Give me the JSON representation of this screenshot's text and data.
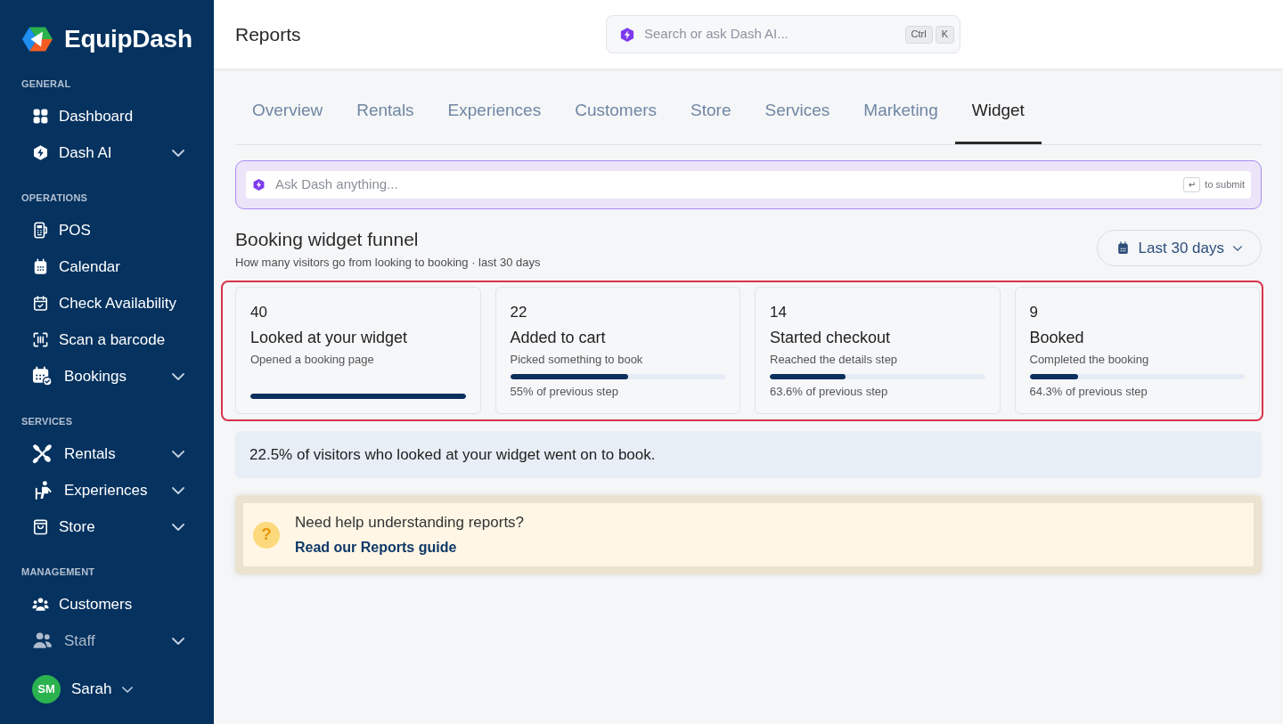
{
  "sidebar": {
    "brand": "EquipDash",
    "sections": [
      {
        "title": "GENERAL",
        "items": [
          {
            "label": "Dashboard",
            "kind": "link",
            "dimmed": false
          },
          {
            "label": "Dash AI",
            "kind": "group",
            "dimmed": false
          }
        ]
      },
      {
        "title": "OPERATIONS",
        "items": [
          {
            "label": "POS",
            "kind": "link",
            "dimmed": false
          },
          {
            "label": "Calendar",
            "kind": "link",
            "dimmed": false
          },
          {
            "label": "Check Availability",
            "kind": "link",
            "dimmed": false
          },
          {
            "label": "Scan a barcode",
            "kind": "link",
            "dimmed": false
          },
          {
            "label": "Bookings",
            "kind": "group",
            "dimmed": false
          }
        ]
      },
      {
        "title": "SERVICES",
        "items": [
          {
            "label": "Rentals",
            "kind": "group",
            "dimmed": false
          },
          {
            "label": "Experiences",
            "kind": "group",
            "dimmed": false
          },
          {
            "label": "Store",
            "kind": "group",
            "dimmed": false
          }
        ]
      },
      {
        "title": "MANAGEMENT",
        "items": [
          {
            "label": "Customers",
            "kind": "link",
            "dimmed": false
          },
          {
            "label": "Staff",
            "kind": "group",
            "dimmed": true
          }
        ]
      }
    ],
    "user": {
      "initials": "SM",
      "name": "Sarah"
    }
  },
  "header": {
    "title": "Reports",
    "search": {
      "placeholder": "Search or ask Dash AI...",
      "shortcut": [
        "Ctrl",
        "K"
      ]
    }
  },
  "tabs": [
    {
      "label": "Overview",
      "selected": false
    },
    {
      "label": "Rentals",
      "selected": false
    },
    {
      "label": "Experiences",
      "selected": false
    },
    {
      "label": "Customers",
      "selected": false
    },
    {
      "label": "Store",
      "selected": false
    },
    {
      "label": "Services",
      "selected": false
    },
    {
      "label": "Marketing",
      "selected": false
    },
    {
      "label": "Widget",
      "selected": true
    }
  ],
  "ask_box": {
    "placeholder": "Ask Dash anything...",
    "submit_key": "↵",
    "submit_hint": "to submit"
  },
  "funnel": {
    "title": "Booking widget funnel",
    "subtitle": "How many visitors go from looking to booking · last 30 days",
    "range_button": "Last 30 days",
    "highlighted": true,
    "steps": [
      {
        "count": "40",
        "title": "Looked at your widget",
        "description": "Opened a booking page",
        "level": 1
      },
      {
        "count": "22",
        "title": "Added to cart",
        "description": "Picked something to book",
        "level": 0.55,
        "comparison": "55% of previous step"
      },
      {
        "count": "14",
        "title": "Started checkout",
        "description": "Reached the details step",
        "level": 0.35,
        "comparison": "63.6% of previous step"
      },
      {
        "count": "9",
        "title": "Booked",
        "description": "Completed the booking",
        "level": 0.225,
        "comparison": "64.3% of previous step"
      }
    ]
  },
  "summary": "22.5% of visitors who looked at your widget went on to book.",
  "help": {
    "icon": "?",
    "question": "Need help understanding reports?",
    "link": "Read our Reports guide"
  }
}
